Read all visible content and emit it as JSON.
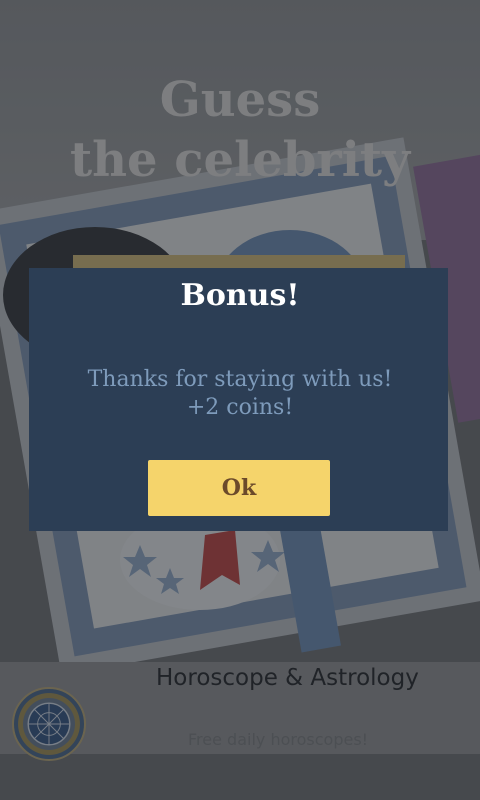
{
  "background": {
    "game_title_line1": "Guess",
    "game_title_line2": "the celebrity"
  },
  "ad": {
    "title": "Horoscope & Astrology",
    "subtitle": "Free daily horoscopes!",
    "logo_icon": "zodiac-wheel-icon"
  },
  "dialog": {
    "title": "Bonus!",
    "message_line1": "Thanks for staying with us!",
    "message_line2": "+2 coins!",
    "ok_label": "Ok"
  },
  "colors": {
    "dialog_bg": "#2c3e55",
    "button_bg": "#f5d46b",
    "message_text": "#7e9bbb"
  }
}
